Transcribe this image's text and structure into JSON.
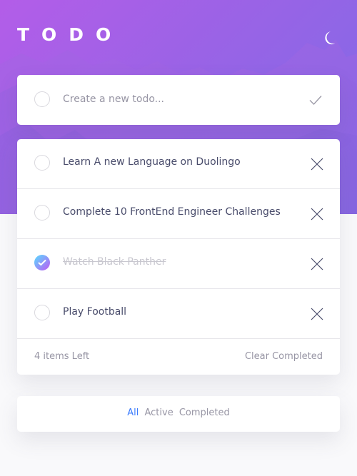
{
  "app": {
    "title": "TODO",
    "theme_toggle_icon": "moon-icon"
  },
  "colors": {
    "hero_gradient_start": "#b35de8",
    "hero_gradient_end": "#7d6be6",
    "accent": "#3a7bfd",
    "check_gradient_start": "#57ddff",
    "check_gradient_end": "#c058f3"
  },
  "new_todo": {
    "placeholder": "Create a new todo...",
    "value": "",
    "submit_icon": "check-icon"
  },
  "todos": [
    {
      "text": "Learn A new Language on Duolingo",
      "completed": false
    },
    {
      "text": "Complete 10 FrontEnd Engineer Challenges",
      "completed": false
    },
    {
      "text": "Watch Black Panther",
      "completed": true
    },
    {
      "text": "Play Football",
      "completed": false
    }
  ],
  "footer": {
    "items_left": "4 items Left",
    "clear_completed": "Clear Completed"
  },
  "filters": {
    "all": "All",
    "active": "Active",
    "completed": "Completed",
    "selected": "All"
  }
}
